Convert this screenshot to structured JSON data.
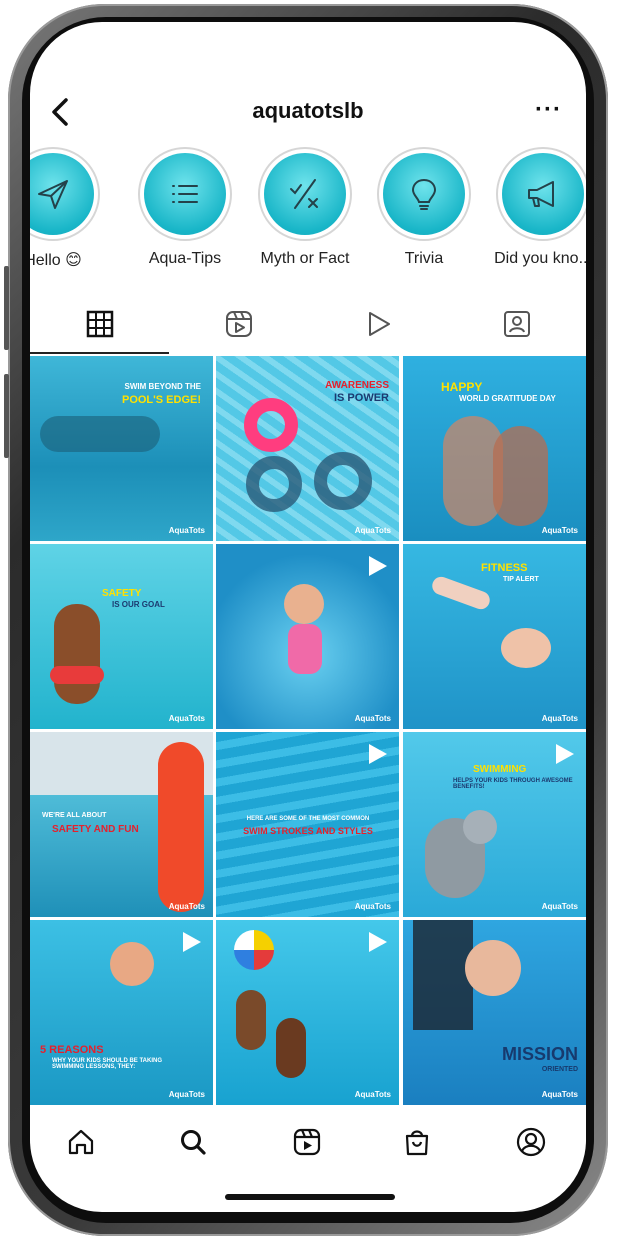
{
  "header": {
    "username": "aquatotslb",
    "more_label": "···"
  },
  "highlights": [
    {
      "label": "Hello 😊",
      "icon": "paper-plane-icon"
    },
    {
      "label": "Aqua-Tips",
      "icon": "list-icon"
    },
    {
      "label": "Myth or Fact",
      "icon": "check-x-icon"
    },
    {
      "label": "Trivia",
      "icon": "lightbulb-icon"
    },
    {
      "label": "Did you kno...",
      "icon": "megaphone-icon"
    }
  ],
  "tabs": [
    {
      "name": "grid",
      "icon": "grid-icon",
      "active": true
    },
    {
      "name": "reels",
      "icon": "reels-icon",
      "active": false
    },
    {
      "name": "videos",
      "icon": "play-icon",
      "active": false
    },
    {
      "name": "tagged",
      "icon": "tagged-person-icon",
      "active": false
    }
  ],
  "posts": [
    {
      "caption_a": "SWIM BEYOND THE",
      "caption_b": "POOL'S EDGE!",
      "is_video": false
    },
    {
      "caption_a": "AWARENESS",
      "caption_b": "IS POWER",
      "is_video": false
    },
    {
      "caption_a": "HAPPY",
      "caption_b": "WORLD GRATITUDE DAY",
      "is_video": false
    },
    {
      "caption_a": "SAFETY",
      "caption_b": "IS OUR GOAL",
      "is_video": false
    },
    {
      "caption_a": "",
      "caption_b": "",
      "is_video": true
    },
    {
      "caption_a": "FITNESS",
      "caption_b": "TIP ALERT",
      "is_video": false
    },
    {
      "caption_a": "WE'RE ALL ABOUT",
      "caption_b": "SAFETY AND FUN",
      "is_video": false
    },
    {
      "caption_a": "HERE ARE SOME OF THE MOST COMMON",
      "caption_b": "SWIM STROKES AND STYLES",
      "is_video": true
    },
    {
      "caption_a": "SWIMMING",
      "caption_b": "HELPS YOUR KIDS THROUGH AWESOME BENEFITS!",
      "is_video": true
    },
    {
      "caption_a": "5 REASONS",
      "caption_b": "WHY YOUR KIDS SHOULD BE TAKING SWIMMING LESSONS, THEY:",
      "is_video": true
    },
    {
      "caption_a": "",
      "caption_b": "",
      "is_video": true
    },
    {
      "caption_a": "MISSION",
      "caption_b": "ORIENTED",
      "is_video": false
    }
  ],
  "watermark": "AquaTots",
  "bottom_nav": [
    {
      "name": "home",
      "icon": "home-icon"
    },
    {
      "name": "search",
      "icon": "search-icon"
    },
    {
      "name": "reels",
      "icon": "reels-icon"
    },
    {
      "name": "shop",
      "icon": "shopping-bag-icon"
    },
    {
      "name": "profile",
      "icon": "profile-icon"
    }
  ],
  "colors": {
    "accent": "#19b6c8",
    "text": "#111111",
    "caption_yellow": "#ffe100",
    "caption_red": "#e6202c"
  }
}
